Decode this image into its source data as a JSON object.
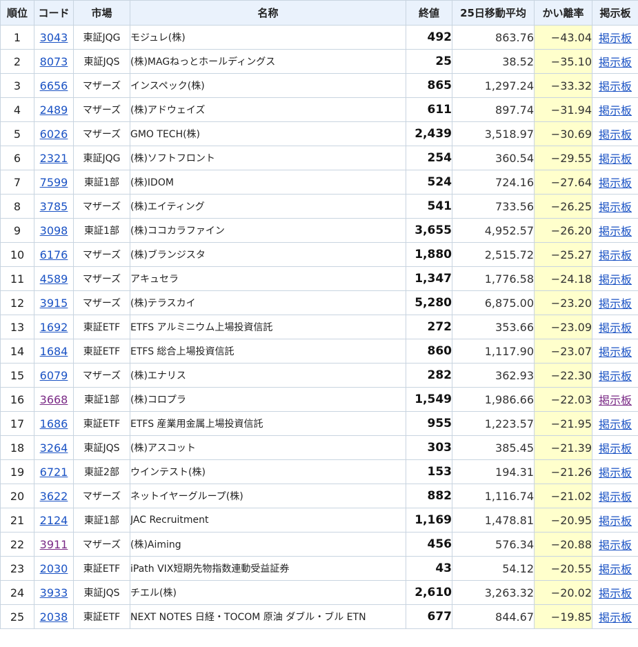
{
  "headers": {
    "rank": "順位",
    "code": "コード",
    "market": "市場",
    "name": "名称",
    "close": "終値",
    "avg25": "25日移動平均",
    "deviation": "かい離率",
    "board": "掲示板"
  },
  "rows": [
    {
      "rank": "1",
      "code": "3043",
      "market": "東証JQG",
      "name": "モジュレ(株)",
      "close": "492",
      "avg25": "863.76",
      "deviation": "−43.04",
      "board": "掲示板"
    },
    {
      "rank": "2",
      "code": "8073",
      "market": "東証JQS",
      "name": "(株)MAGねっとホールディングス",
      "close": "25",
      "avg25": "38.52",
      "deviation": "−35.10",
      "board": "掲示板"
    },
    {
      "rank": "3",
      "code": "6656",
      "market": "マザーズ",
      "name": "インスペック(株)",
      "close": "865",
      "avg25": "1,297.24",
      "deviation": "−33.32",
      "board": "掲示板"
    },
    {
      "rank": "4",
      "code": "2489",
      "market": "マザーズ",
      "name": "(株)アドウェイズ",
      "close": "611",
      "avg25": "897.74",
      "deviation": "−31.94",
      "board": "掲示板"
    },
    {
      "rank": "5",
      "code": "6026",
      "market": "マザーズ",
      "name": "GMO TECH(株)",
      "close": "2,439",
      "avg25": "3,518.97",
      "deviation": "−30.69",
      "board": "掲示板"
    },
    {
      "rank": "6",
      "code": "2321",
      "market": "東証JQG",
      "name": "(株)ソフトフロント",
      "close": "254",
      "avg25": "360.54",
      "deviation": "−29.55",
      "board": "掲示板"
    },
    {
      "rank": "7",
      "code": "7599",
      "market": "東証1部",
      "name": "(株)IDOM",
      "close": "524",
      "avg25": "724.16",
      "deviation": "−27.64",
      "board": "掲示板"
    },
    {
      "rank": "8",
      "code": "3785",
      "market": "マザーズ",
      "name": "(株)エイティング",
      "close": "541",
      "avg25": "733.56",
      "deviation": "−26.25",
      "board": "掲示板"
    },
    {
      "rank": "9",
      "code": "3098",
      "market": "東証1部",
      "name": "(株)ココカラファイン",
      "close": "3,655",
      "avg25": "4,952.57",
      "deviation": "−26.20",
      "board": "掲示板"
    },
    {
      "rank": "10",
      "code": "6176",
      "market": "マザーズ",
      "name": "(株)ブランジスタ",
      "close": "1,880",
      "avg25": "2,515.72",
      "deviation": "−25.27",
      "board": "掲示板"
    },
    {
      "rank": "11",
      "code": "4589",
      "market": "マザーズ",
      "name": "アキュセラ",
      "close": "1,347",
      "avg25": "1,776.58",
      "deviation": "−24.18",
      "board": "掲示板"
    },
    {
      "rank": "12",
      "code": "3915",
      "market": "マザーズ",
      "name": "(株)テラスカイ",
      "close": "5,280",
      "avg25": "6,875.00",
      "deviation": "−23.20",
      "board": "掲示板"
    },
    {
      "rank": "13",
      "code": "1692",
      "market": "東証ETF",
      "name": "ETFS アルミニウム上場投資信託",
      "close": "272",
      "avg25": "353.66",
      "deviation": "−23.09",
      "board": "掲示板"
    },
    {
      "rank": "14",
      "code": "1684",
      "market": "東証ETF",
      "name": "ETFS 総合上場投資信託",
      "close": "860",
      "avg25": "1,117.90",
      "deviation": "−23.07",
      "board": "掲示板"
    },
    {
      "rank": "15",
      "code": "6079",
      "market": "マザーズ",
      "name": "(株)エナリス",
      "close": "282",
      "avg25": "362.93",
      "deviation": "−22.30",
      "board": "掲示板"
    },
    {
      "rank": "16",
      "code": "3668",
      "market": "東証1部",
      "name": "(株)コロプラ",
      "close": "1,549",
      "avg25": "1,986.66",
      "deviation": "−22.03",
      "board": "掲示板",
      "visited": true
    },
    {
      "rank": "17",
      "code": "1686",
      "market": "東証ETF",
      "name": "ETFS 産業用金属上場投資信託",
      "close": "955",
      "avg25": "1,223.57",
      "deviation": "−21.95",
      "board": "掲示板"
    },
    {
      "rank": "18",
      "code": "3264",
      "market": "東証JQS",
      "name": "(株)アスコット",
      "close": "303",
      "avg25": "385.45",
      "deviation": "−21.39",
      "board": "掲示板"
    },
    {
      "rank": "19",
      "code": "6721",
      "market": "東証2部",
      "name": "ウインテスト(株)",
      "close": "153",
      "avg25": "194.31",
      "deviation": "−21.26",
      "board": "掲示板"
    },
    {
      "rank": "20",
      "code": "3622",
      "market": "マザーズ",
      "name": "ネットイヤーグループ(株)",
      "close": "882",
      "avg25": "1,116.74",
      "deviation": "−21.02",
      "board": "掲示板"
    },
    {
      "rank": "21",
      "code": "2124",
      "market": "東証1部",
      "name": "JAC Recruitment",
      "close": "1,169",
      "avg25": "1,478.81",
      "deviation": "−20.95",
      "board": "掲示板"
    },
    {
      "rank": "22",
      "code": "3911",
      "market": "マザーズ",
      "name": "(株)Aiming",
      "close": "456",
      "avg25": "576.34",
      "deviation": "−20.88",
      "board": "掲示板",
      "code_visited": true
    },
    {
      "rank": "23",
      "code": "2030",
      "market": "東証ETF",
      "name": "iPath VIX短期先物指数連動受益証券",
      "close": "43",
      "avg25": "54.12",
      "deviation": "−20.55",
      "board": "掲示板"
    },
    {
      "rank": "24",
      "code": "3933",
      "market": "東証JQS",
      "name": "チエル(株)",
      "close": "2,610",
      "avg25": "3,263.32",
      "deviation": "−20.02",
      "board": "掲示板"
    },
    {
      "rank": "25",
      "code": "2038",
      "market": "東証ETF",
      "name": "NEXT NOTES 日経・TOCOM 原油 ダブル・ブル ETN",
      "close": "677",
      "avg25": "844.67",
      "deviation": "−19.85",
      "board": "掲示板"
    }
  ]
}
